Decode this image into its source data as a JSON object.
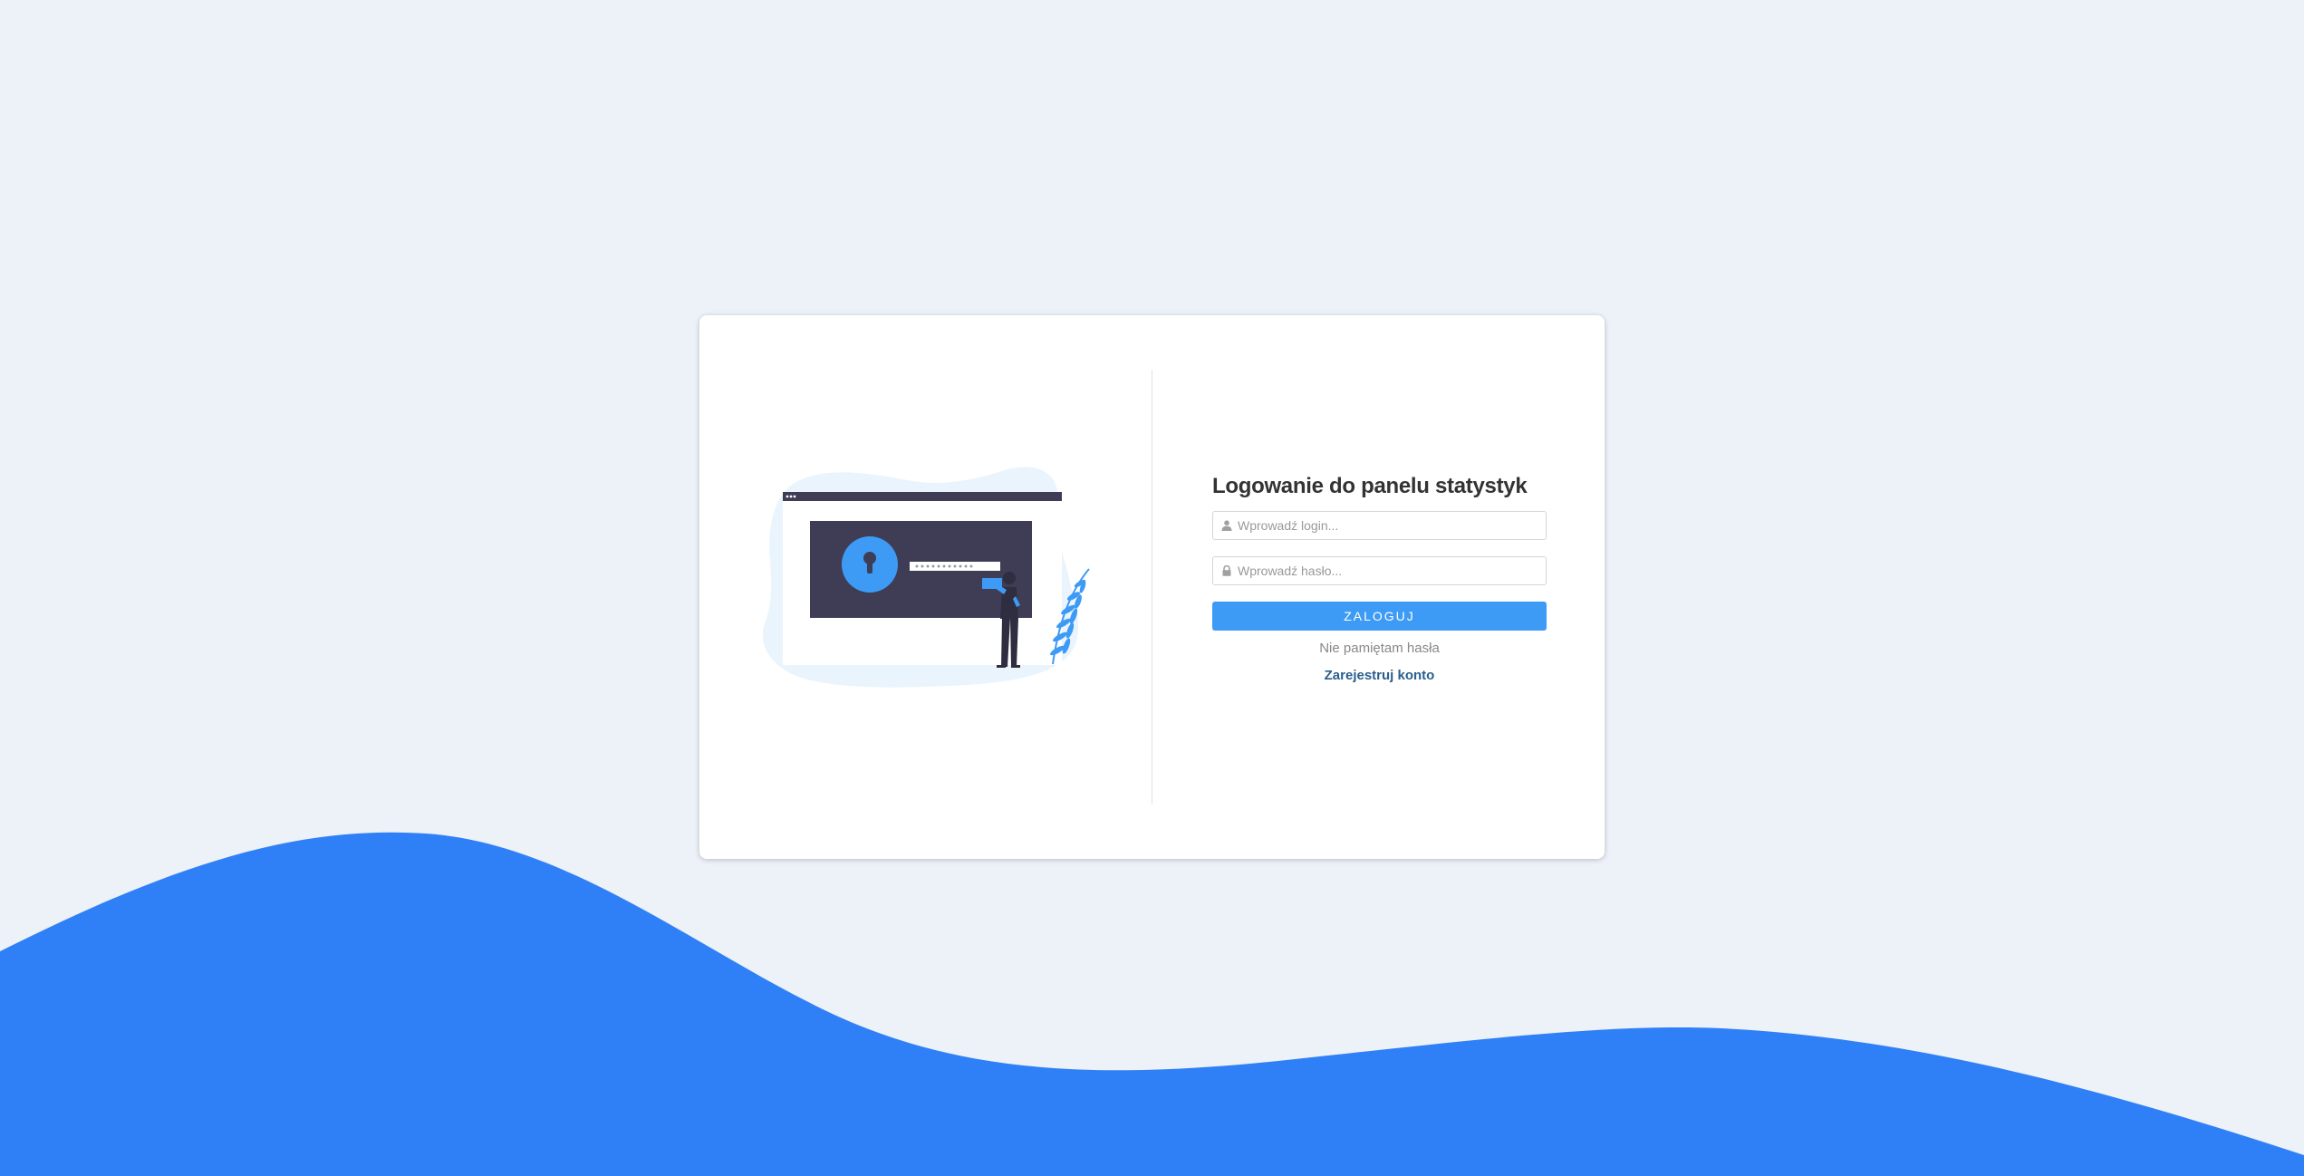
{
  "login": {
    "title": "Logowanie do panelu statystyk",
    "login_placeholder": "Wprowadź login...",
    "password_placeholder": "Wprowadź hasło...",
    "submit_label": "ZALOGUJ",
    "forgot_label": "Nie pamiętam hasła",
    "register_label": "Zarejestruj konto"
  },
  "icons": {
    "login_field": "user-icon",
    "password_field": "lock-icon"
  },
  "colors": {
    "background": "#edf1f8",
    "wave": "#2f80f7",
    "button": "#3e9bf5",
    "register_link": "#2a5e8c",
    "illustration_dark": "#3f3d56"
  }
}
